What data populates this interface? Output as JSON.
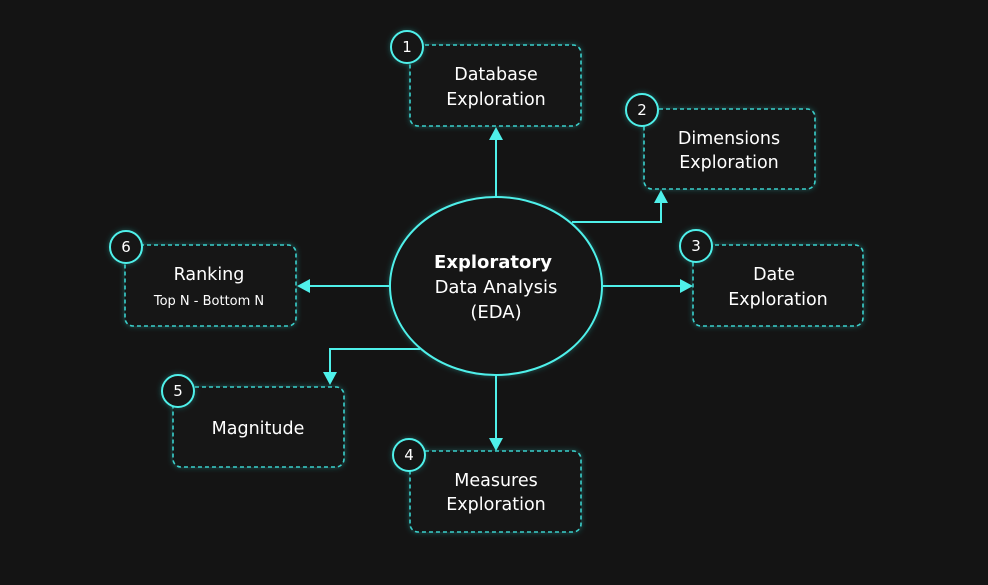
{
  "center": {
    "title": "Exploratory",
    "line2": "Data Analysis",
    "line3": "(EDA)"
  },
  "nodes": {
    "database": {
      "number": "1",
      "line1": "Database",
      "line2": "Exploration"
    },
    "dimensions": {
      "number": "2",
      "line1": "Dimensions",
      "line2": "Exploration"
    },
    "date": {
      "number": "3",
      "line1": "Date",
      "line2": "Exploration"
    },
    "measures": {
      "number": "4",
      "line1": "Measures",
      "line2": "Exploration"
    },
    "magnitude": {
      "number": "5",
      "line1": "Magnitude"
    },
    "ranking": {
      "number": "6",
      "line1": "Ranking",
      "line2": "Top N - Bottom N"
    }
  },
  "colors": {
    "background": "#141414",
    "accent": "#4ff0ea",
    "text": "#ffffff"
  }
}
